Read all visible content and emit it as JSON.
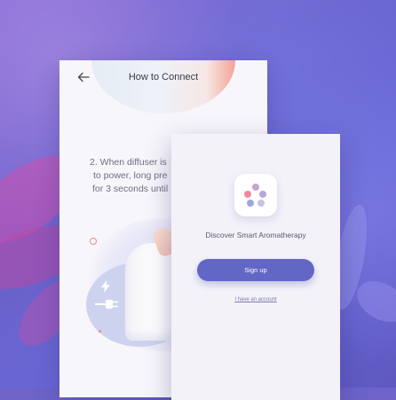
{
  "screen_back": {
    "title": "How to Connect",
    "back_icon": "arrow-left-icon",
    "instructions": [
      "2. When diffuser is",
      "to power, long pre",
      "for 3 seconds until"
    ]
  },
  "screen_front": {
    "logo_icon": "aroma-dots-logo",
    "tagline": "Discover Smart Aromatherapy",
    "signup_label": "Sign up",
    "have_account_label": "I have an account"
  },
  "colors": {
    "background": "#6d63c9",
    "accent": "#6266c4",
    "card": "#f3f2f9",
    "logo_dots": [
      "#c9a3cf",
      "#f08a9a",
      "#b7a6dc",
      "#9ea7d8",
      "#c7c2e8"
    ]
  }
}
